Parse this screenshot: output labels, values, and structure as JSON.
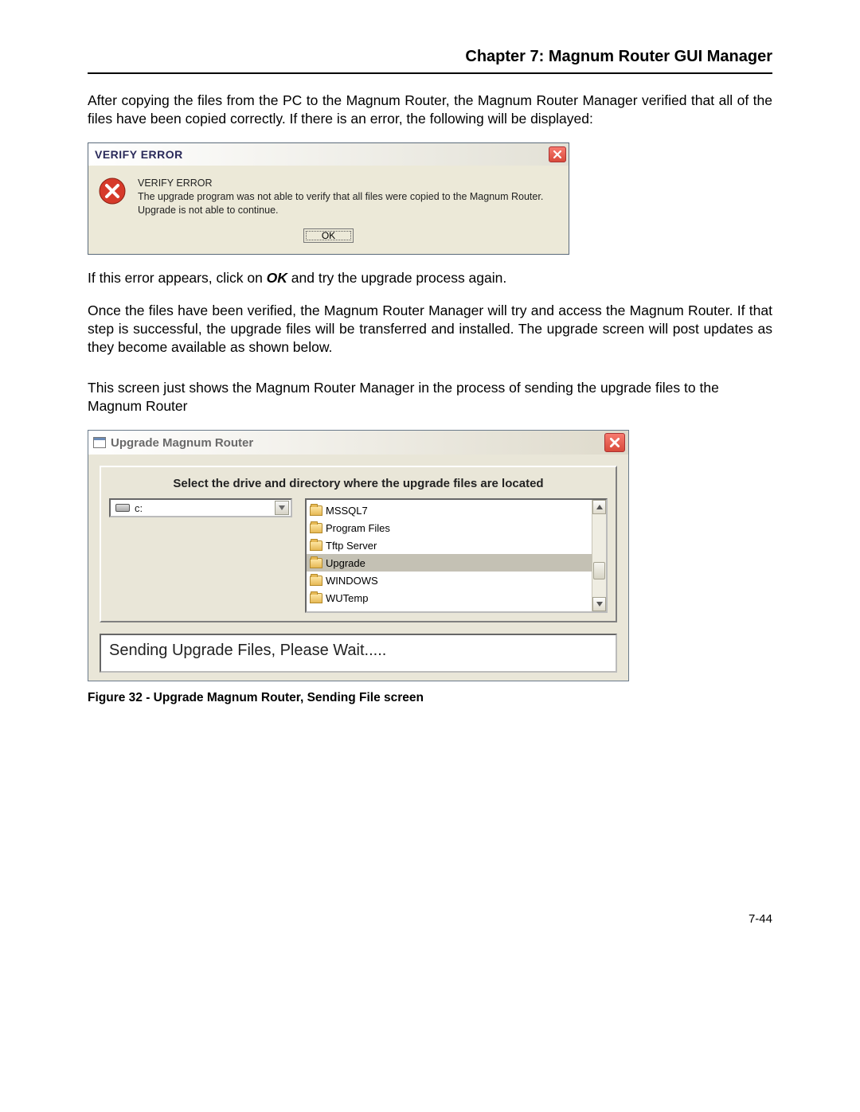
{
  "chapter_title": "Chapter 7: Magnum Router GUI Manager",
  "para1": "After copying the files from the PC to the Magnum Router, the Magnum Router Manager verified that all of the files have been copied correctly.  If there is an error, the following will be displayed:",
  "verify_dialog": {
    "title": "VERIFY ERROR",
    "msg_header": "VERIFY ERROR",
    "msg_line1": "The upgrade program was not able to verify that all files were copied to the Magnum Router.",
    "msg_line2": "Upgrade is not able to continue.",
    "ok_label": "OK"
  },
  "para2_pre": "If this error appears, click on ",
  "para2_ok": "OK",
  "para2_post": " and try the upgrade process again.",
  "para3": "Once the files have been verified, the Magnum Router Manager will try and access the Magnum Router.  If that step is successful, the upgrade files will be transferred and installed.  The upgrade screen will post updates as they become available as shown below.",
  "para4": "This screen just shows the Magnum Router Manager in the process of sending the upgrade files to the Magnum Router",
  "upgrade_dialog": {
    "title": "Upgrade Magnum Router",
    "panel_title": "Select the drive and directory where the upgrade files are located",
    "drive_selected": "c:",
    "folders": [
      "MSSQL7",
      "Program Files",
      "Tftp Server",
      "Upgrade",
      "WINDOWS",
      "WUTemp"
    ],
    "selected_folder": "Upgrade",
    "status": "Sending Upgrade Files, Please Wait....."
  },
  "figure_caption": "Figure 32 - Upgrade Magnum Router, Sending File screen",
  "page_number": "7-44"
}
